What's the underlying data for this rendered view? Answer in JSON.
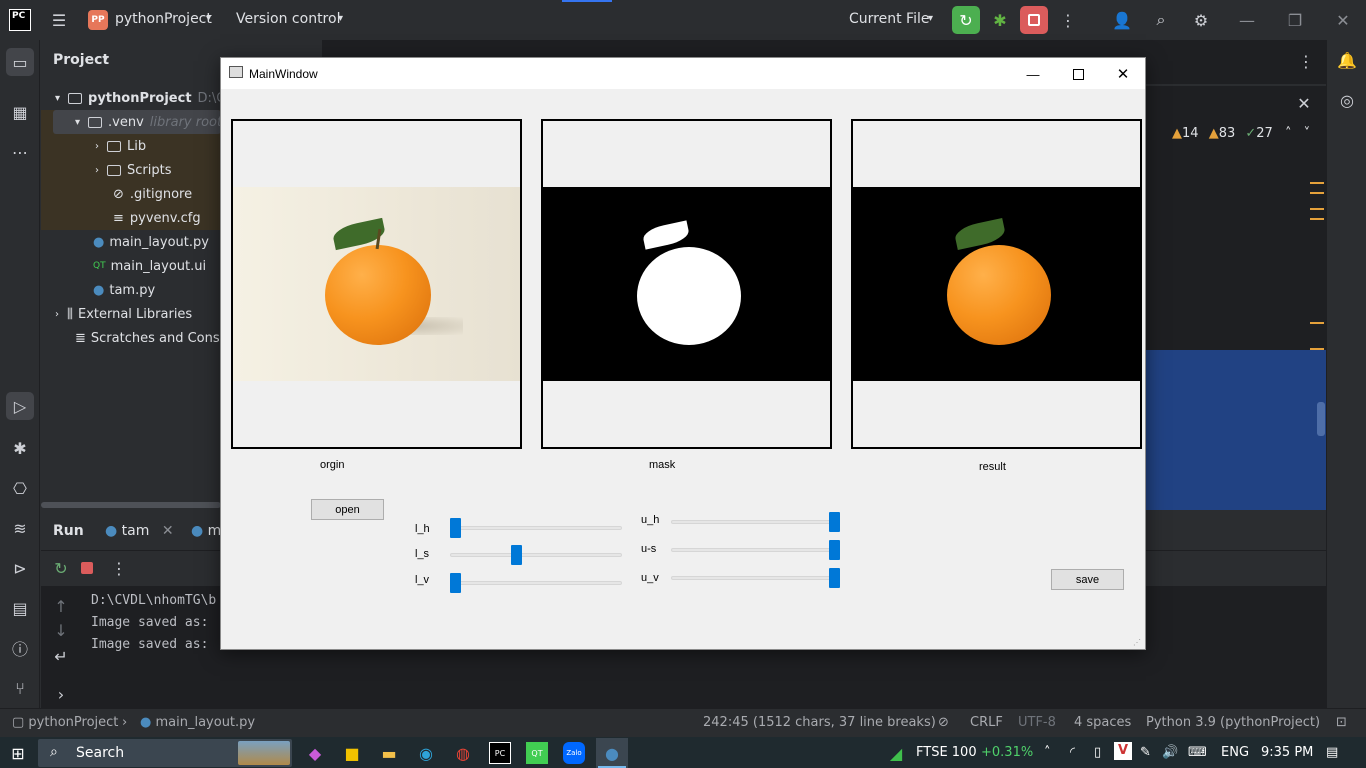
{
  "ide": {
    "logo": "PC",
    "project_badge": "PP",
    "project_name": "pythonProject",
    "version_control": "Version control",
    "run_config": "Current File"
  },
  "project_panel": {
    "title": "Project",
    "items": [
      {
        "label": "pythonProject",
        "hint": "D:\\CVDL\\nhomTG\\b"
      },
      {
        "label": ".venv",
        "hint": "library root"
      },
      {
        "label": "Lib"
      },
      {
        "label": "Scripts"
      },
      {
        "label": ".gitignore"
      },
      {
        "label": "pyvenv.cfg"
      },
      {
        "label": "main_layout.py"
      },
      {
        "label": "main_layout.ui"
      },
      {
        "label": "tam.py"
      },
      {
        "label": "External Libraries"
      },
      {
        "label": "Scratches and Conso"
      }
    ]
  },
  "editor": {
    "inspections": {
      "errors": "14",
      "warnings": "83",
      "weak": "27"
    }
  },
  "run_panel": {
    "title": "Run",
    "tabs": [
      "tam",
      "m"
    ],
    "console": [
      "D:\\CVDL\\nhomTG\\b",
      "Image saved as:",
      "Image saved as:"
    ]
  },
  "statusbar": {
    "breadcrumb_project": "pythonProject",
    "breadcrumb_file": "main_layout.py",
    "position": "242:45 (1512 chars, 37 line breaks)",
    "line_sep": "CRLF",
    "encoding": "UTF-8",
    "indent": "4 spaces",
    "interpreter": "Python 3.9 (pythonProject)"
  },
  "taskbar": {
    "search": "Search",
    "stock_name": "FTSE 100",
    "stock_change": "+0.31%",
    "lang": "ENG",
    "time": "9:35 PM"
  },
  "qt_window": {
    "title": "MainWindow",
    "label_origin": "orgin",
    "label_mask": "mask",
    "label_result": "result",
    "open_button": "open",
    "save_button": "save",
    "sliders": [
      {
        "label": "l_h",
        "value": 0.0
      },
      {
        "label": "l_s",
        "value": 0.38
      },
      {
        "label": "l_v",
        "value": 0.0
      },
      {
        "label": "u_h",
        "value": 1.0
      },
      {
        "label": "u-s",
        "value": 1.0
      },
      {
        "label": "u_v",
        "value": 1.0
      }
    ]
  },
  "colors": {
    "ide_bg": "#2b2d30",
    "editor_bg": "#1e1f22",
    "accent": "#0078d7",
    "orange": "#f7931e",
    "run_green": "#4caf50",
    "stop_red": "#db5c5c"
  }
}
